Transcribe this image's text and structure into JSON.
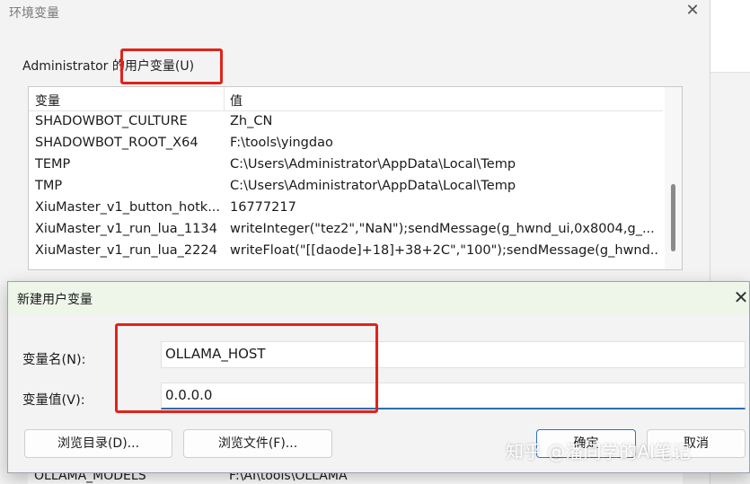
{
  "background_window": {
    "title": "环境变量",
    "close_glyph": "✕",
    "section_label": "Administrator 的用户变量(U)",
    "columns": [
      "变量",
      "值"
    ],
    "rows": [
      {
        "name": "SHADOWBOT_CULTURE",
        "value": "Zh_CN"
      },
      {
        "name": "SHADOWBOT_ROOT_X64",
        "value": "F:\\tools\\yingdao"
      },
      {
        "name": "TEMP",
        "value": "C:\\Users\\Administrator\\AppData\\Local\\Temp"
      },
      {
        "name": "TMP",
        "value": "C:\\Users\\Administrator\\AppData\\Local\\Temp"
      },
      {
        "name": "XiuMaster_v1_button_hotk...",
        "value": "16777217"
      },
      {
        "name": "XiuMaster_v1_run_lua_1134",
        "value": "writeInteger(\"tez2\",\"NaN\");sendMessage(g_hwnd_ui,0x8004,g_..."
      },
      {
        "name": "XiuMaster_v1_run_lua_2224",
        "value": "writeFloat(\"[[daode]+18]+38+2C\",\"100\");sendMessage(g_hwnd..."
      }
    ],
    "partial_row": {
      "name": "OLLAMA_MODELS",
      "value": "F:\\AI\\tools\\OLLAMA"
    }
  },
  "dialog": {
    "title": "新建用户变量",
    "close_glyph": "✕",
    "name_label": "变量名(N):",
    "name_value": "OLLAMA_HOST",
    "value_label": "变量值(V):",
    "value_value": "0.0.0.0",
    "buttons": {
      "browse_dir": "浏览目录(D)...",
      "browse_file": "浏览文件(F)...",
      "ok": "确定",
      "cancel": "取消"
    }
  },
  "watermark": "知乎 @潘同学的AI笔记",
  "colors": {
    "highlight": "#e1231b",
    "focus": "#2b6fb0",
    "dialog_titlebar": "#eef5e9"
  }
}
